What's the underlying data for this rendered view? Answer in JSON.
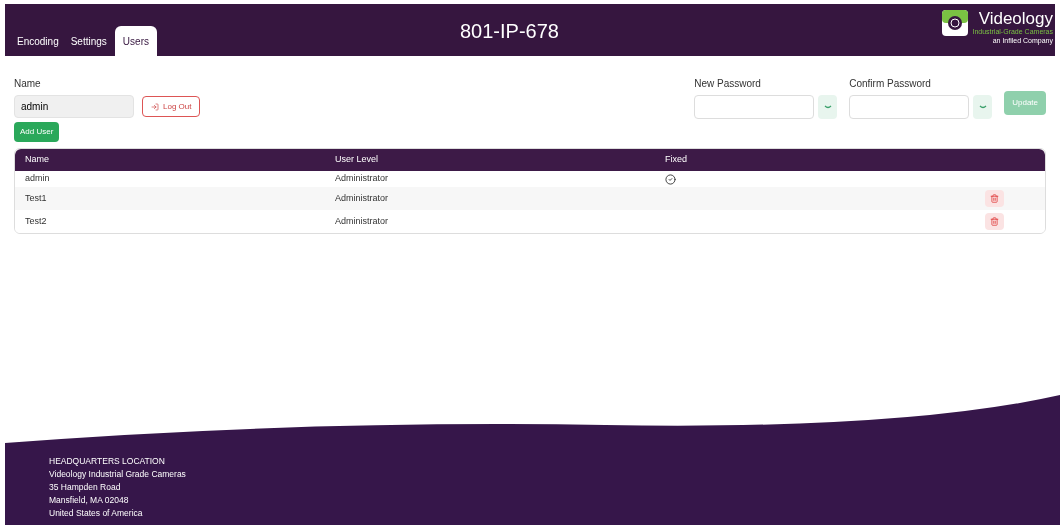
{
  "header": {
    "tabs": [
      {
        "label": "Encoding",
        "selected": false
      },
      {
        "label": "Settings",
        "selected": false
      },
      {
        "label": "Users",
        "selected": true
      }
    ],
    "title": "801-IP-678",
    "logo": {
      "name": "Videology",
      "tagline": "Industrial-Grade Cameras",
      "subline": "an Infiled Company"
    }
  },
  "user": {
    "label": "Name",
    "value": "admin",
    "logout": "Log Out",
    "add_user": "Add User"
  },
  "password": {
    "new_label": "New Password",
    "confirm_label": "Confirm Password",
    "update": "Update",
    "update_disabled": true
  },
  "table": {
    "columns": [
      "Name",
      "User Level",
      "Fixed"
    ],
    "rows": [
      {
        "name": "admin",
        "level_text": "Administrator",
        "fixed": true
      },
      {
        "name": "Test1",
        "level_text": "Administrator",
        "fixed": false
      },
      {
        "name": "Test2",
        "level_text": "Administrator",
        "fixed": false
      }
    ]
  },
  "footer": {
    "lines": [
      "HEADQUARTERS LOCATION",
      "Videology Industrial Grade Cameras",
      "35 Hampden Road",
      "Mansfield, MA 02048",
      "United States of America"
    ]
  }
}
